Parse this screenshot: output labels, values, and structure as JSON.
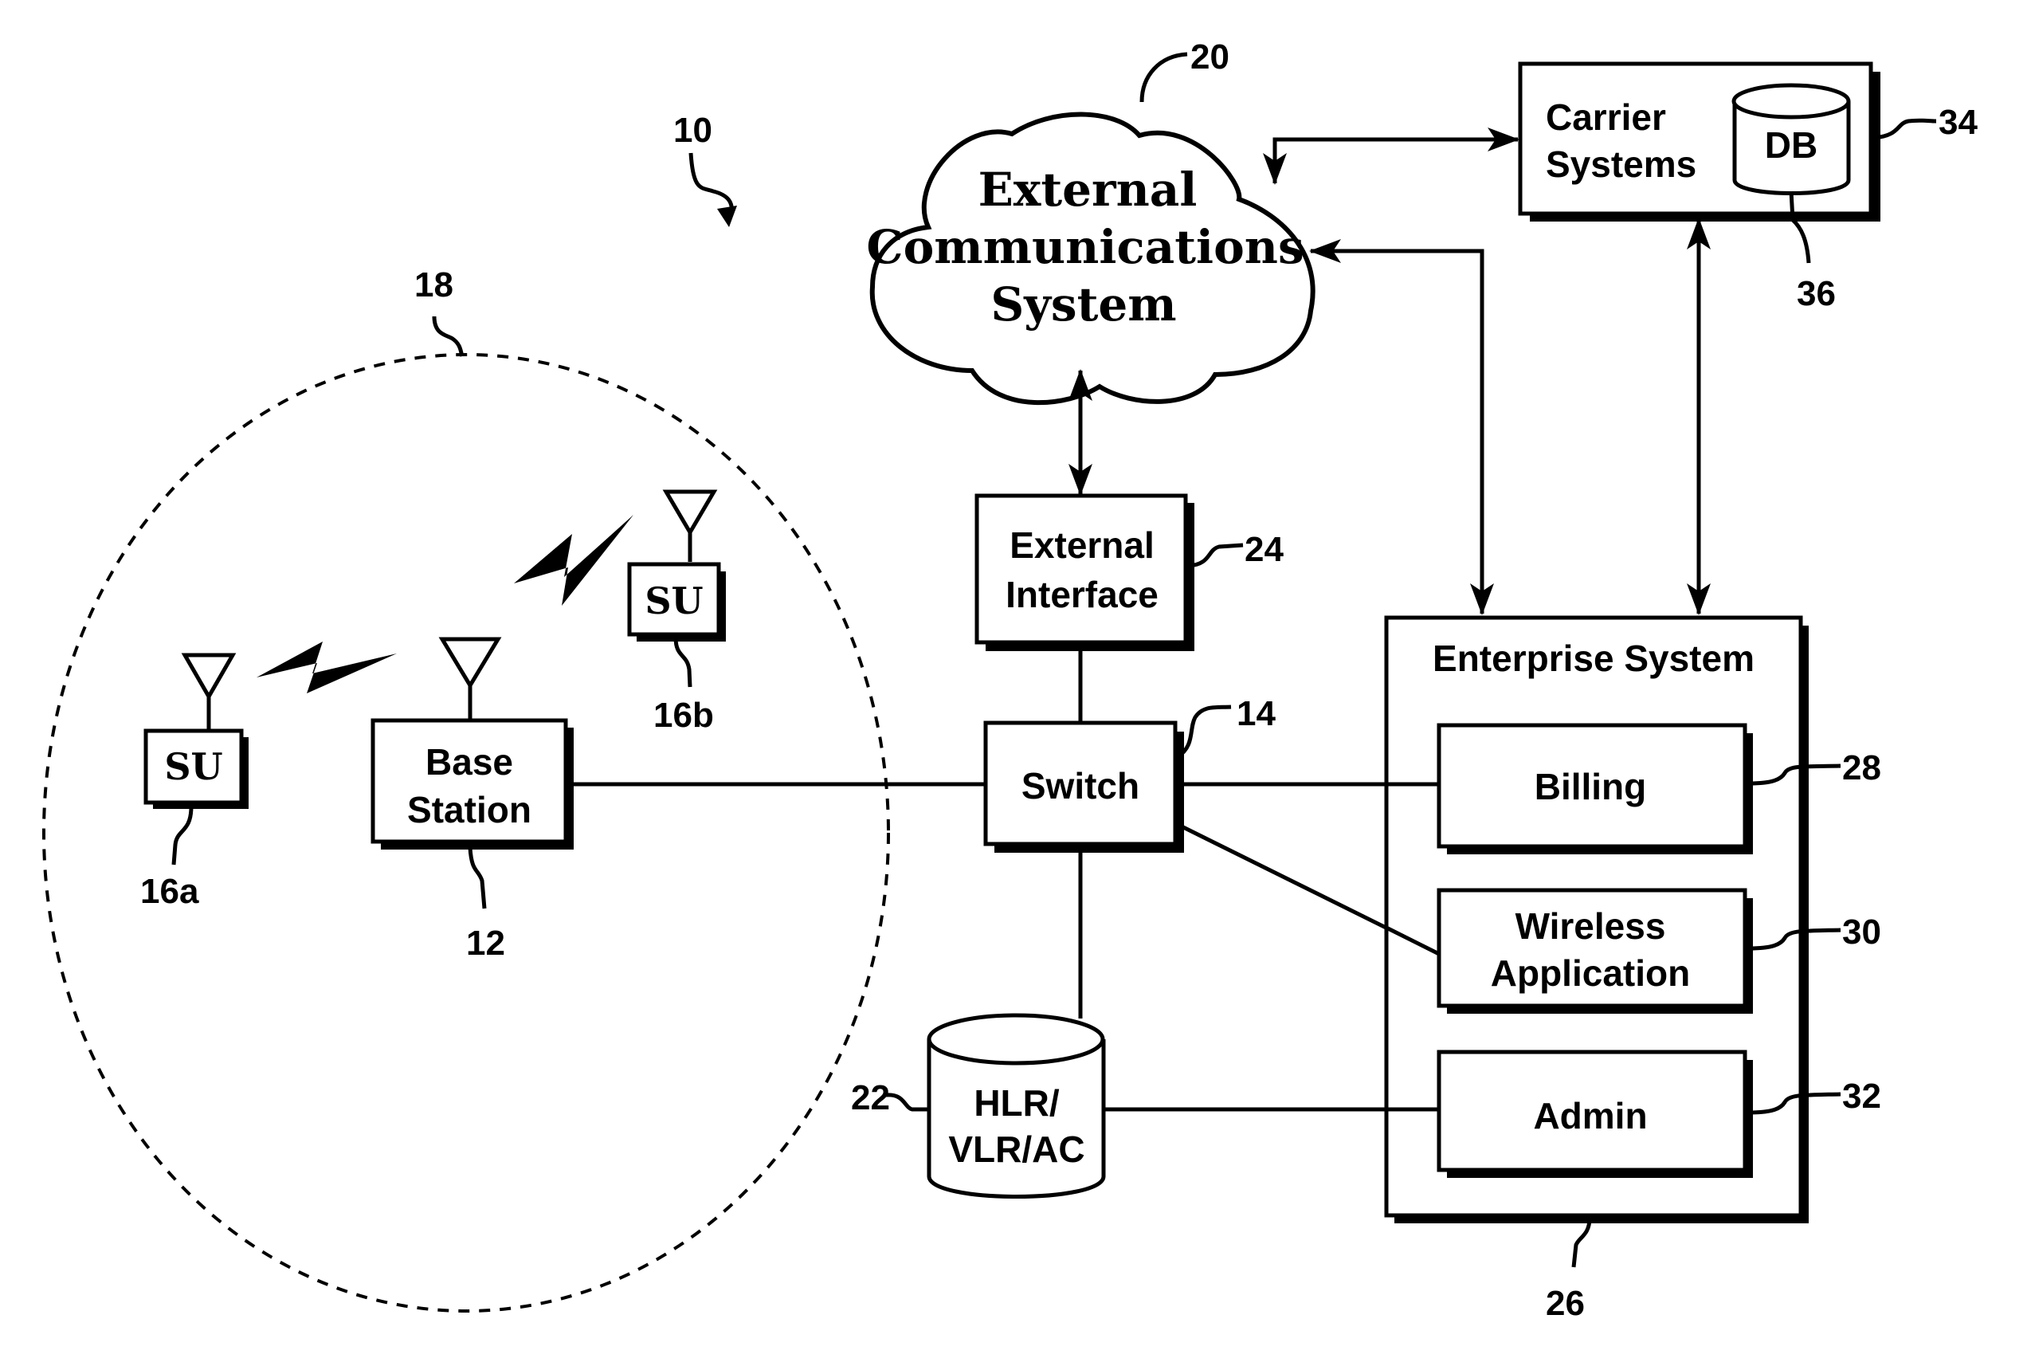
{
  "figure": {
    "system_ref": "10",
    "coverage_area": {
      "ref": "18"
    },
    "subscriber_units": [
      {
        "label": "SU",
        "ref": "16a"
      },
      {
        "label": "SU",
        "ref": "16b"
      }
    ],
    "base_station": {
      "line1": "Base",
      "line2": "Station",
      "ref": "12"
    },
    "switch": {
      "label": "Switch",
      "ref": "14"
    },
    "external_interface": {
      "line1": "External",
      "line2": "Interface",
      "ref": "24"
    },
    "external_comm": {
      "line1": "External",
      "line2": "Communications",
      "line3": "System",
      "ref": "20"
    },
    "hlr": {
      "line1": "HLR/",
      "line2": "VLR/AC",
      "ref": "22"
    },
    "carrier": {
      "line1": "Carrier",
      "line2": "Systems",
      "db_label": "DB",
      "ref": "34",
      "db_ref": "36"
    },
    "enterprise": {
      "title": "Enterprise System",
      "ref": "26",
      "modules": [
        {
          "line1": "Billing",
          "line2": "",
          "ref": "28"
        },
        {
          "line1": "Wireless",
          "line2": "Application",
          "ref": "30"
        },
        {
          "line1": "Admin",
          "line2": "",
          "ref": "32"
        }
      ]
    }
  }
}
